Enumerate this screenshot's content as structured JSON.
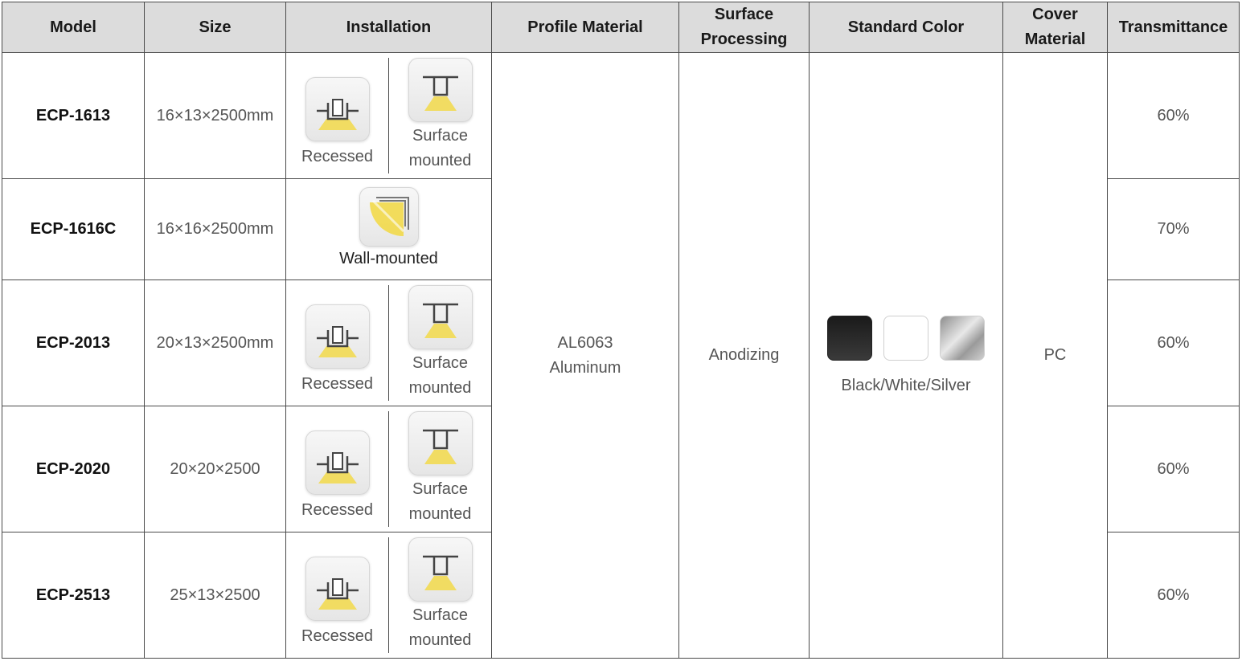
{
  "headers": {
    "model": "Model",
    "size": "Size",
    "installation": "Installation",
    "profile_material": "Profile Material",
    "surface_processing": "Surface Processing",
    "standard_color": "Standard Color",
    "cover_material": "Cover Material",
    "transmittance": "Transmittance"
  },
  "rows": [
    {
      "model": "ECP-1613",
      "size": "16×13×2500mm",
      "transmittance": "60%"
    },
    {
      "model": "ECP-1616C",
      "size": "16×16×2500mm",
      "transmittance": "70%"
    },
    {
      "model": "ECP-2013",
      "size": "20×13×2500mm",
      "transmittance": "60%"
    },
    {
      "model": "ECP-2020",
      "size": "20×20×2500",
      "transmittance": "60%"
    },
    {
      "model": "ECP-2513",
      "size": "25×13×2500",
      "transmittance": "60%"
    }
  ],
  "installation": {
    "recessed": "Recessed",
    "surface_line1": "Surface",
    "surface_line2": "mounted",
    "wall": "Wall-mounted"
  },
  "icons": {
    "recessed": "recessed-mount-icon",
    "surface": "surface-mount-icon",
    "wall": "wall-corner-mount-icon"
  },
  "profile_material": {
    "line1": "AL6063",
    "line2": "Aluminum"
  },
  "surface_processing": "Anodizing",
  "standard_color": {
    "label": "Black/White/Silver",
    "swatches": [
      {
        "name": "black",
        "color": "#1c1c1c"
      },
      {
        "name": "white",
        "color": "#ffffff"
      },
      {
        "name": "silver",
        "color": "#b8b8b8"
      }
    ]
  },
  "cover_material": "PC",
  "colors": {
    "header_bg": "#dcdcdc",
    "light_yellow": "#f2d94a"
  }
}
